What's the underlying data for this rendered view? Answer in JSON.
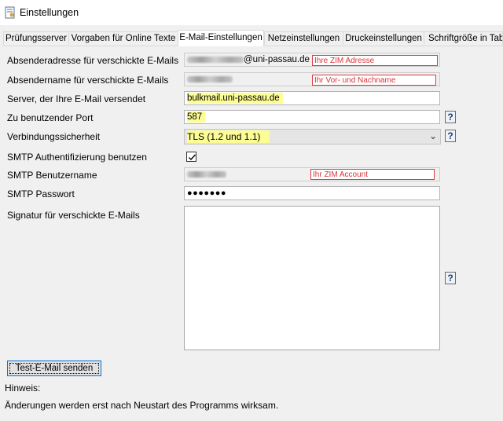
{
  "window": {
    "title": "Einstellungen"
  },
  "tabs": [
    {
      "label": "Prüfungsserver"
    },
    {
      "label": "Vorgaben für Online Texte"
    },
    {
      "label": "E-Mail-Einstellungen"
    },
    {
      "label": "Netzeinstellungen"
    },
    {
      "label": "Druckeinstellungen"
    },
    {
      "label": "Schriftgröße in Tab"
    }
  ],
  "form": {
    "sender_address": {
      "label": "Absenderadresse für verschickte E-Mails",
      "value_suffix": "@uni-passau.de",
      "hint": "Ihre ZIM Adresse"
    },
    "sender_name": {
      "label": "Absendername für verschickte E-Mails",
      "hint": "Ihr Vor- und Nachname"
    },
    "server": {
      "label": "Server, der Ihre E-Mail versendet",
      "value": "bulkmail.uni-passau.de"
    },
    "port": {
      "label": "Zu benutzender Port",
      "value": "587"
    },
    "security": {
      "label": "Verbindungssicherheit",
      "value": "TLS (1.2 und 1.1)"
    },
    "smtp_auth": {
      "label": "SMTP Authentifizierung benutzen",
      "checked": true
    },
    "smtp_user": {
      "label": "SMTP Benutzername",
      "hint": "Ihr ZIM Account"
    },
    "smtp_password": {
      "label": "SMTP Passwort",
      "value": "●●●●●●●"
    },
    "signature": {
      "label": "Signatur für verschickte E-Mails"
    }
  },
  "help_label": "?",
  "test_button": {
    "label": "Test-E-Mail senden"
  },
  "note": {
    "heading": "Hinweis:",
    "text": "Änderungen werden erst nach Neustart des Programms wirksam."
  },
  "icons": {
    "app": "settings-window-icon",
    "help": "help-icon",
    "dropdown": "chevron-down-icon",
    "check": "checkmark-icon"
  },
  "colors": {
    "highlight": "#fdfd96",
    "hint_border": "#e0393e",
    "focus_border": "#0a70d6"
  }
}
